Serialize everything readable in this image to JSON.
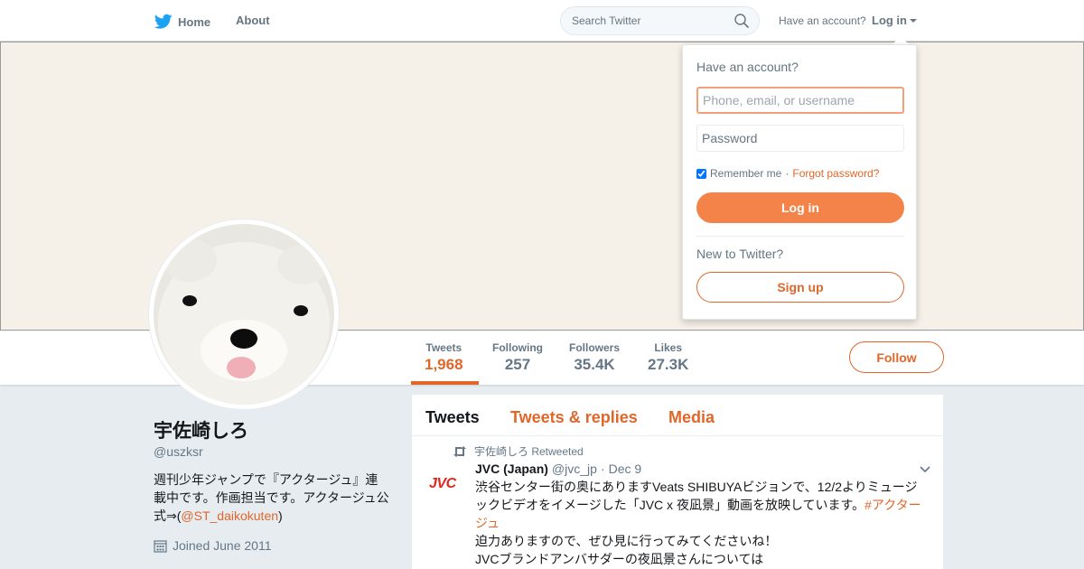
{
  "nav": {
    "home_label": "Home",
    "about_label": "About",
    "search_placeholder": "Search Twitter",
    "have_account": "Have an account?",
    "login_label": "Log in"
  },
  "stats": [
    {
      "label": "Tweets",
      "value": "1,968"
    },
    {
      "label": "Following",
      "value": "257"
    },
    {
      "label": "Followers",
      "value": "35.4K"
    },
    {
      "label": "Likes",
      "value": "27.3K"
    }
  ],
  "follow_label": "Follow",
  "profile": {
    "name": "宇佐崎しろ",
    "handle": "@uszksr",
    "bio_text": "週刊少年ジャンプで『アクタージュ』連載中です。作画担当です。アクタージュ公式⇒(",
    "bio_mention": "@ST_daikokuten",
    "bio_end": ")",
    "joined": "Joined June 2011"
  },
  "timeline": {
    "tabs": [
      "Tweets",
      "Tweets & replies",
      "Media"
    ],
    "tweet": {
      "retweeted_by": "宇佐崎しろ Retweeted",
      "avatar_text": "JVC",
      "author": "JVC (Japan)",
      "handle": "@jvc_jp",
      "separator": "·",
      "date": "Dec 9",
      "text_line1": "渋谷センター街の奥にありますVeats SHIBUYAビジョンで、12/2よりミュージックビデオをイメージした「JVC x 夜凪景」動画を放映しています。",
      "hashtag": "#アクタージュ",
      "text_line2": "迫力ありますので、ぜひ見に行ってみてくださいね！",
      "text_line3": "JVCブランドアンバサダーの夜凪景さんについては"
    }
  },
  "dropdown": {
    "title": "Have an account?",
    "username_placeholder": "Phone, email, or username",
    "password_placeholder": "Password",
    "remember_label": "Remember me",
    "separator": "·",
    "forgot_label": "Forgot password?",
    "login_button": "Log in",
    "new_label": "New to Twitter?",
    "signup_button": "Sign up"
  },
  "colors": {
    "accent": "#e0662a",
    "button_fill": "#f4834a",
    "twitter_blue": "#1da1f2"
  },
  "icons": [
    "twitter-bird-icon",
    "search-icon",
    "calendar-icon",
    "retweet-icon",
    "chevron-down-icon"
  ]
}
